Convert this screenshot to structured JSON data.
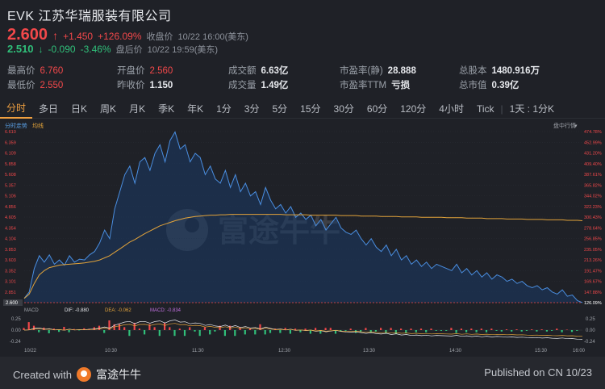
{
  "header": {
    "title": "EVK 江苏华瑞服装有限公司",
    "price": "2.600",
    "change": "+1.450",
    "change_pct": "+126.09%",
    "close_label": "收盘价",
    "close_time": "10/22 16:00(美东)",
    "after_price": "2.510",
    "after_change": "-0.090",
    "after_change_pct": "-3.46%",
    "after_label": "盘后价",
    "after_time": "10/22 19:59(美东)"
  },
  "stats": [
    {
      "k": "最高价",
      "v": "6.760",
      "style": "red"
    },
    {
      "k": "开盘价",
      "v": "2.560",
      "style": "red"
    },
    {
      "k": "成交额",
      "v": "6.63亿",
      "style": "white"
    },
    {
      "k": "市盈率(静)",
      "v": "28.888",
      "style": "white"
    },
    {
      "k": "总股本",
      "v": "1480.916万",
      "style": "white"
    },
    {
      "k": "最低价",
      "v": "2.550",
      "style": "red"
    },
    {
      "k": "昨收价",
      "v": "1.150",
      "style": "white"
    },
    {
      "k": "成交量",
      "v": "1.49亿",
      "style": "white"
    },
    {
      "k": "市盈率TTM",
      "v": "亏损",
      "style": "white"
    },
    {
      "k": "总市值",
      "v": "0.39亿",
      "style": "white"
    }
  ],
  "tabs": [
    "分时",
    "多日",
    "日K",
    "周K",
    "月K",
    "季K",
    "年K",
    "1分",
    "3分",
    "5分",
    "15分",
    "30分",
    "60分",
    "120分",
    "4小时",
    "Tick",
    "1天 : 1分K"
  ],
  "active_tab": 0,
  "chart_labels": {
    "left_label_a": "分时走势",
    "left_label_b": "均线",
    "right_label": "盘中行情",
    "watermark": "富途牛牛",
    "macd_title": "MACD",
    "dif": "DIF: -0.880",
    "dea": "DEA: -0.062",
    "macd_val": "MACD: -0.834",
    "sub_ticks": [
      "0.25",
      "0.00",
      "-0.24"
    ]
  },
  "chart_data": {
    "type": "line",
    "x_ticks": [
      "10/22",
      "10:30",
      "11:30",
      "12:30",
      "13:30",
      "14:30",
      "15:30",
      "16:00"
    ],
    "y_ticks_price": [
      "6.610",
      "6.359",
      "6.109",
      "5.858",
      "5.608",
      "5.357",
      "5.106",
      "4.856",
      "4.605",
      "4.354",
      "4.104",
      "3.853",
      "3.603",
      "3.352",
      "3.101",
      "2.851",
      "2.600"
    ],
    "y_ticks_pct": [
      "474.78%",
      "452.99%",
      "431.20%",
      "409.40%",
      "387.61%",
      "365.82%",
      "344.02%",
      "322.23%",
      "300.43%",
      "278.64%",
      "256.85%",
      "235.05%",
      "213.26%",
      "191.47%",
      "169.67%",
      "147.88%",
      "126.09%"
    ],
    "ylim": [
      2.6,
      6.61
    ],
    "series": [
      {
        "values": [
          2.7,
          2.85,
          3.4,
          3.7,
          3.55,
          3.72,
          3.5,
          3.6,
          3.48,
          3.7,
          3.55,
          3.62,
          3.6,
          3.72,
          3.8,
          4.0,
          4.3,
          4.1,
          4.8,
          5.2,
          5.6,
          5.8,
          5.4,
          5.9,
          6.0,
          5.7,
          6.1,
          6.3,
          5.9,
          6.4,
          6.6,
          6.2,
          6.3,
          5.9,
          6.1,
          6.0,
          5.6,
          5.8,
          5.5,
          5.4,
          5.7,
          5.3,
          5.6,
          5.2,
          5.4,
          5.1,
          5.2,
          4.9,
          5.3,
          5.0,
          4.8,
          4.9,
          4.7,
          4.85,
          4.6,
          4.7,
          4.55,
          4.65,
          4.4,
          4.55,
          4.3,
          4.45,
          4.6,
          4.35,
          4.25,
          4.2,
          4.3,
          4.1,
          3.95,
          4.1,
          3.9,
          3.8,
          3.95,
          3.7,
          3.85,
          3.6,
          3.7,
          3.5,
          3.6,
          3.45,
          3.55,
          3.4,
          3.5,
          3.45,
          3.4,
          3.35,
          3.5,
          3.3,
          3.4,
          3.25,
          3.35,
          3.2,
          3.3,
          3.15,
          3.25,
          3.2,
          3.1,
          3.15,
          3.05,
          3.1,
          3.0,
          2.95,
          3.0,
          2.9,
          2.95,
          2.85,
          2.8,
          2.9,
          2.75,
          2.78,
          2.65,
          2.6
        ]
      },
      {
        "values": [
          2.7,
          2.8,
          3.05,
          3.25,
          3.35,
          3.42,
          3.45,
          3.48,
          3.49,
          3.5,
          3.51,
          3.52,
          3.53,
          3.55,
          3.57,
          3.6,
          3.65,
          3.7,
          3.78,
          3.86,
          3.94,
          4.02,
          4.08,
          4.15,
          4.22,
          4.28,
          4.34,
          4.4,
          4.44,
          4.48,
          4.52,
          4.55,
          4.58,
          4.6,
          4.62,
          4.63,
          4.64,
          4.65,
          4.65,
          4.66,
          4.66,
          4.67,
          4.67,
          4.67,
          4.67,
          4.67,
          4.67,
          4.67,
          4.67,
          4.67,
          4.67,
          4.67,
          4.66,
          4.66,
          4.66,
          4.66,
          4.66,
          4.65,
          4.65,
          4.65,
          4.65,
          4.65,
          4.65,
          4.64,
          4.64,
          4.64,
          4.64,
          4.63,
          4.63,
          4.63,
          4.63,
          4.62,
          4.62,
          4.62,
          4.62,
          4.61,
          4.61,
          4.61,
          4.61,
          4.6,
          4.6,
          4.6,
          4.6,
          4.6,
          4.59,
          4.59,
          4.59,
          4.59,
          4.58,
          4.58,
          4.58,
          4.58,
          4.57,
          4.57,
          4.57,
          4.57,
          4.56,
          4.56,
          4.56,
          4.56,
          4.55,
          4.55,
          4.55,
          4.55,
          4.54,
          4.54,
          4.54,
          4.54,
          4.53,
          4.53,
          4.53,
          4.52
        ]
      }
    ]
  }
}
